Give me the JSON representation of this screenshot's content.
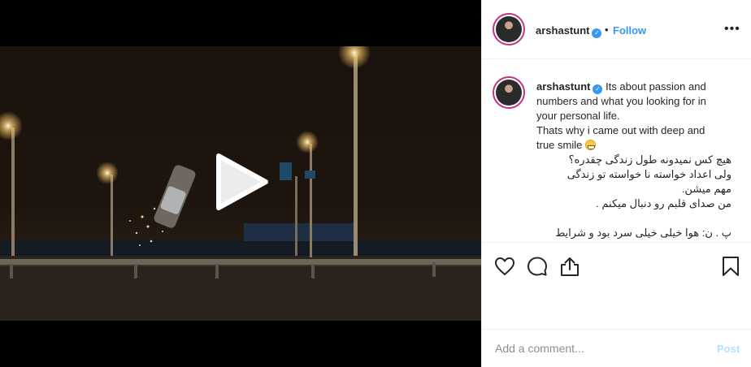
{
  "colors": {
    "accent": "#3897f0",
    "post_disabled": "#b2dffc",
    "text": "#262626",
    "avatar_ring": "#c13584"
  },
  "video": {
    "play_icon": "play-icon"
  },
  "header": {
    "username": "arshastunt",
    "verified_icon": "verified-badge-icon",
    "separator": "•",
    "follow_label": "Follow",
    "more_icon": "more-options-icon"
  },
  "caption": {
    "username": "arshastunt",
    "lines": [
      "Its about passion and",
      "numbers and what you looking for in",
      "your personal life.",
      "Thats why i came out with deep and",
      "true smile",
      "هیچ کس نمیدونه طول زندگی چقدره؟",
      "ولی اعداد خواسته نا خواسته تو زندگی",
      "مهم میشن.",
      "من صدای قلبم رو دنبال میکنم .",
      "",
      "پ . ن: هوا خیلی خیلی سرد بود و شرایط"
    ],
    "emoji_icon": "grinning-face-icon"
  },
  "actions": {
    "like_icon": "heart-icon",
    "comment_icon": "comment-icon",
    "share_icon": "share-icon",
    "save_icon": "bookmark-icon"
  },
  "comment": {
    "placeholder": "Add a comment...",
    "post_label": "Post"
  }
}
